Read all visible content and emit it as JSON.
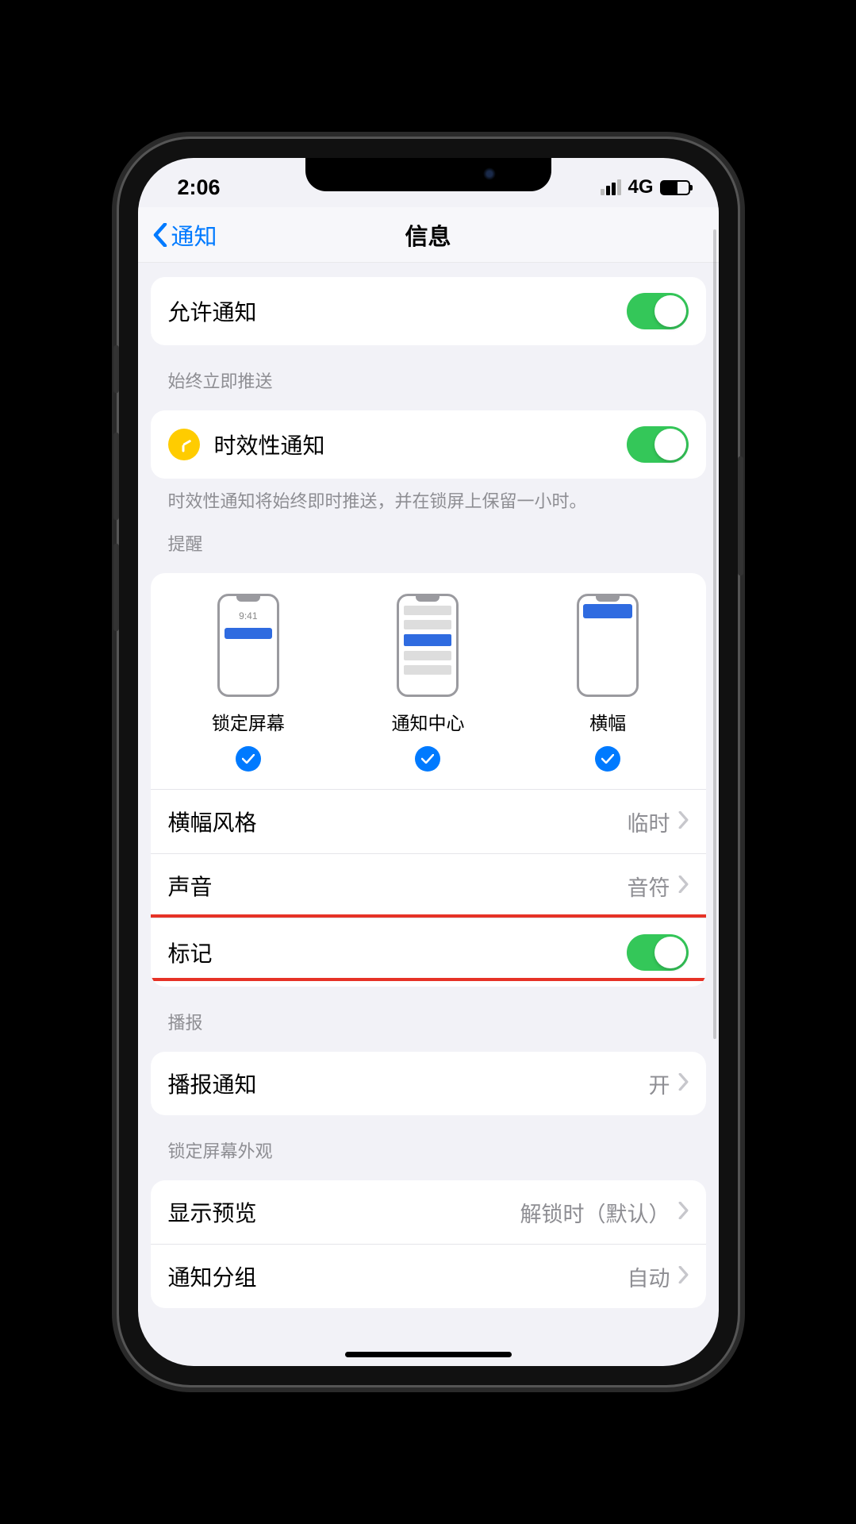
{
  "status": {
    "time": "2:06",
    "network": "4G"
  },
  "nav": {
    "back": "通知",
    "title": "信息"
  },
  "allow_notifications": {
    "label": "允许通知",
    "on": true
  },
  "delivery": {
    "header": "始终立即推送",
    "time_sensitive": {
      "label": "时效性通知",
      "on": true
    },
    "footer": "时效性通知将始终即时推送，并在锁屏上保留一小时。"
  },
  "alerts": {
    "header": "提醒",
    "lock_screen": {
      "label": "锁定屏幕",
      "time": "9:41",
      "checked": true
    },
    "notification_center": {
      "label": "通知中心",
      "checked": true
    },
    "banners": {
      "label": "横幅",
      "checked": true
    },
    "banner_style": {
      "label": "横幅风格",
      "value": "临时"
    },
    "sounds": {
      "label": "声音",
      "value": "音符"
    },
    "badges": {
      "label": "标记",
      "on": true
    }
  },
  "announce": {
    "header": "播报",
    "announce_notifications": {
      "label": "播报通知",
      "value": "开"
    }
  },
  "lockscreen_appearance": {
    "header": "锁定屏幕外观",
    "show_previews": {
      "label": "显示预览",
      "value": "解锁时（默认）"
    },
    "notification_grouping": {
      "label": "通知分组",
      "value": "自动"
    }
  }
}
